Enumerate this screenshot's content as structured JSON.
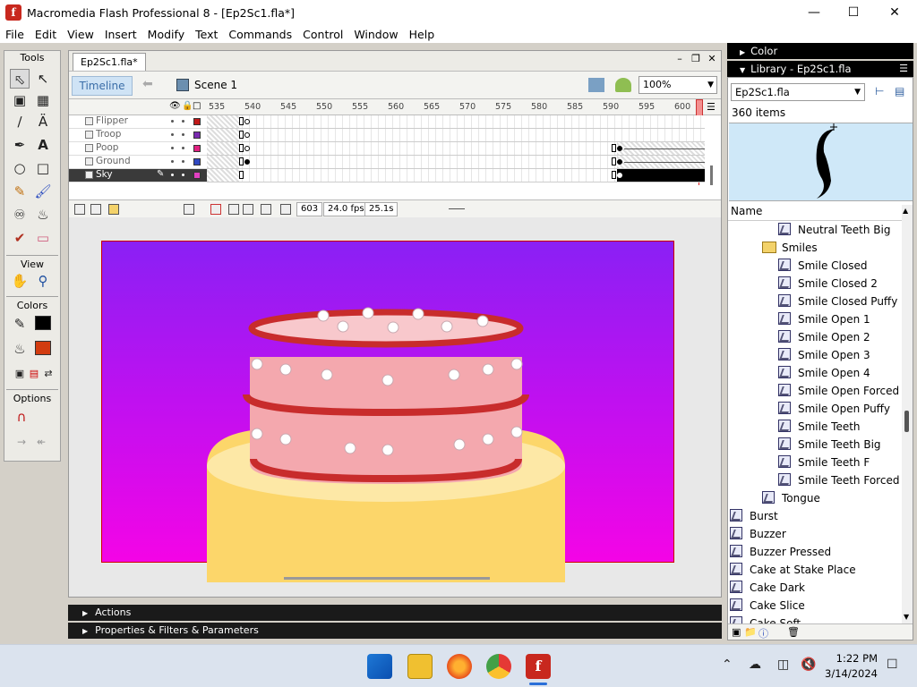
{
  "window": {
    "title": "Macromedia Flash Professional 8 - [Ep2Sc1.fla*]",
    "app_icon": "f",
    "controls": [
      "minimize-icon",
      "maximize-icon",
      "close-icon"
    ]
  },
  "menu": [
    "File",
    "Edit",
    "View",
    "Insert",
    "Modify",
    "Text",
    "Commands",
    "Control",
    "Window",
    "Help"
  ],
  "tools": {
    "title": "Tools",
    "view_label": "View",
    "colors_label": "Colors",
    "options_label": "Options",
    "stroke_color": "#000000",
    "fill_color": "#d23c10"
  },
  "document": {
    "tab": "Ep2Sc1.fla*",
    "timeline_label": "Timeline",
    "scene": "Scene 1",
    "zoom": "100%",
    "frame_numbers": [
      "535",
      "540",
      "545",
      "550",
      "555",
      "560",
      "565",
      "570",
      "575",
      "580",
      "585",
      "590",
      "595",
      "600"
    ],
    "layers": [
      {
        "name": "Flipper",
        "color": "#c01818"
      },
      {
        "name": "Troop",
        "color": "#7a2ab0"
      },
      {
        "name": "Poop",
        "color": "#e02080"
      },
      {
        "name": "Ground",
        "color": "#3048c0"
      },
      {
        "name": "Sky",
        "color": "#e040c0"
      }
    ],
    "current_frame": "603",
    "fps": "24.0 fps",
    "time": "25.1s",
    "stage_colors": {
      "top": "#8a20f4",
      "bottom": "#f404e6"
    }
  },
  "panels": {
    "actions": "Actions",
    "properties": "Properties & Filters & Parameters",
    "color": "Color",
    "library": "Library - Ep2Sc1.fla"
  },
  "library": {
    "document": "Ep2Sc1.fla",
    "count": "360 items",
    "column": "Name",
    "items": [
      {
        "label": "Neutral Teeth Big",
        "type": "symbol",
        "indent": 2
      },
      {
        "label": "Smiles",
        "type": "folder",
        "indent": 1
      },
      {
        "label": "Smile Closed",
        "type": "symbol",
        "indent": 2
      },
      {
        "label": "Smile Closed 2",
        "type": "symbol",
        "indent": 2
      },
      {
        "label": "Smile Closed Puffy",
        "type": "symbol",
        "indent": 2
      },
      {
        "label": "Smile Open 1",
        "type": "symbol",
        "indent": 2
      },
      {
        "label": "Smile Open 2",
        "type": "symbol",
        "indent": 2
      },
      {
        "label": "Smile Open 3",
        "type": "symbol",
        "indent": 2
      },
      {
        "label": "Smile Open 4",
        "type": "symbol",
        "indent": 2
      },
      {
        "label": "Smile Open Forced",
        "type": "symbol",
        "indent": 2
      },
      {
        "label": "Smile Open Puffy",
        "type": "symbol",
        "indent": 2
      },
      {
        "label": "Smile Teeth",
        "type": "symbol",
        "indent": 2
      },
      {
        "label": "Smile Teeth Big",
        "type": "symbol",
        "indent": 2
      },
      {
        "label": "Smile Teeth F",
        "type": "symbol",
        "indent": 2
      },
      {
        "label": "Smile Teeth Forced",
        "type": "symbol",
        "indent": 2
      },
      {
        "label": "Tongue",
        "type": "symbol",
        "indent": 1
      },
      {
        "label": "Burst",
        "type": "symbol",
        "indent": 0
      },
      {
        "label": "Buzzer",
        "type": "symbol",
        "indent": 0
      },
      {
        "label": "Buzzer Pressed",
        "type": "symbol",
        "indent": 0
      },
      {
        "label": "Cake at Stake Place",
        "type": "symbol",
        "indent": 0
      },
      {
        "label": "Cake Dark",
        "type": "symbol",
        "indent": 0
      },
      {
        "label": "Cake Slice",
        "type": "symbol",
        "indent": 0
      },
      {
        "label": "Cake Soft",
        "type": "symbol",
        "indent": 0
      }
    ]
  },
  "taskbar": {
    "apps": [
      "windows-start-icon",
      "file-explorer-icon",
      "firefox-icon",
      "chrome-icon",
      "flash-icon"
    ],
    "time": "1:22 PM",
    "date": "3/14/2024"
  }
}
